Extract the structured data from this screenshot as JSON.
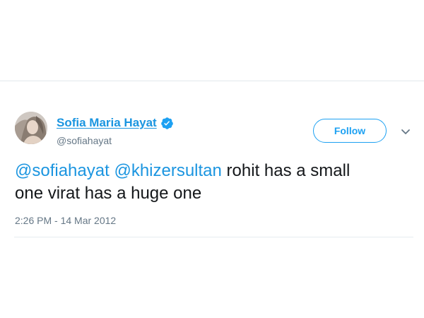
{
  "user": {
    "display_name": "Sofia Maria Hayat",
    "handle": "@sofiahayat",
    "verified": true
  },
  "actions": {
    "follow_label": "Follow"
  },
  "tweet": {
    "mention_1": "@sofiahayat",
    "mention_2": "@khizersultan",
    "text_line_1_rest": " rohit has a small",
    "text_line_2": "one virat has a huge one"
  },
  "timestamp": "2:26 PM - 14 Mar 2012",
  "colors": {
    "link": "#1b95e0",
    "accent": "#1da1f2",
    "text": "#14171a",
    "secondary": "#657786"
  },
  "icons": {
    "verified": "verified-badge-icon",
    "chevron": "chevron-down-icon"
  }
}
